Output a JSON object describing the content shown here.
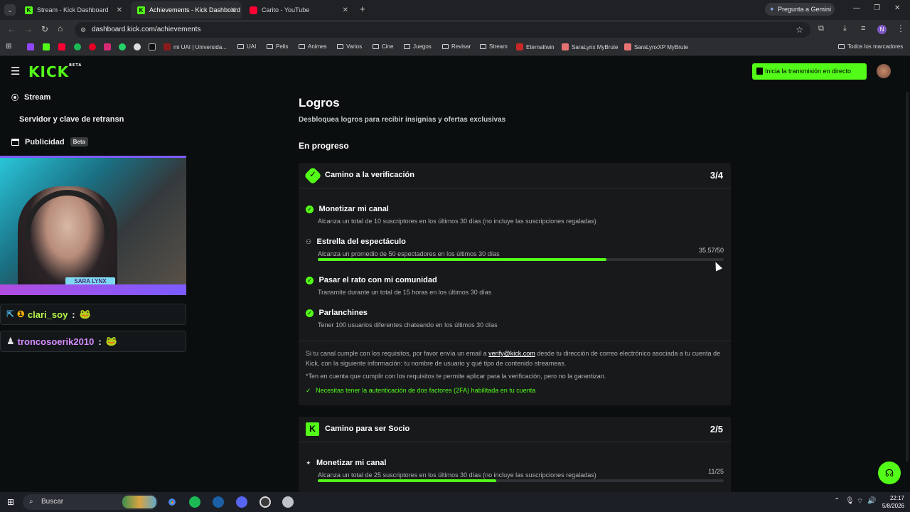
{
  "browser": {
    "tabs": [
      {
        "title": "Stream - Kick Dashboard",
        "active": false
      },
      {
        "title": "Achievements - Kick Dashboard",
        "active": true
      },
      {
        "title": "Carito - YouTube",
        "active": false
      }
    ],
    "gemini_label": "Pregunta a Gemini",
    "url": "dashboard.kick.com/achievements",
    "profile_initial": "N",
    "bookmarks": [
      "mi UAI | Universida...",
      "UAI",
      "Pelis",
      "Animes",
      "Varios",
      "Cine",
      "Juegos",
      "Revisar",
      "Stream",
      "Eternaltwin",
      "SaraLynx MyBrute",
      "SaraLynxXP MyBrute"
    ],
    "all_bookmarks_label": "Todos los marcadores"
  },
  "app": {
    "logo": "KICK",
    "logo_badge": "BETA",
    "go_live_label": "Inicia la transmisión en directo"
  },
  "sidebar": {
    "stream": "Stream",
    "server_key": "Servidor y clave de retransn",
    "ads": "Publicidad",
    "ads_badge": "Beta",
    "cam_overlay_name": "SARA LYNX",
    "chat": [
      {
        "user": "clari_soy",
        "sep": ":"
      },
      {
        "user": "troncosoerik2010",
        "sep": ":"
      }
    ]
  },
  "page": {
    "title": "Logros",
    "subtitle": "Desbloquea logros para recibir insignias y ofertas exclusivas",
    "section": "En progreso",
    "verification": {
      "title": "Camino a la verificación",
      "count": "3/4",
      "items": [
        {
          "title": "Monetizar mi canal",
          "desc": "Alcanza un total de 10 suscriptores en los últimos 30 días (no incluye las suscripciones regaladas)",
          "done": true
        },
        {
          "title": "Estrella del espectáculo",
          "desc": "Alcanza un promedio de 50 espectadores en los últimos 30 días",
          "done": false,
          "progress_text": "35.57/50",
          "progress": 0.7114
        },
        {
          "title": "Pasar el rato con mi comunidad",
          "desc": "Transmite durante un total de 15 horas en los últimos 30 días",
          "done": true
        },
        {
          "title": "Parlanchines",
          "desc": "Tener 100 usuarios diferentes chateando en los últimos 30 días",
          "done": true
        }
      ],
      "note_pre": "Si tu canal cumple con los requisitos, por favor envía un email a ",
      "note_email": "verify@kick.com",
      "note_post": " desde tu dirección de correo electrónico asociada a tu cuenta de Kick, con la siguiente información: tu nombre de usuario y qué tipo de contenido streameas.",
      "note2": "*Ten en cuenta que cumplir con los requisitos te permite aplicar para la verificación, pero no la garantizan.",
      "twofa": "Necesitas tener la autenticación de dos factores (2FA) habilitada en tu cuenta"
    },
    "partner": {
      "title": "Camino para ser Socio",
      "count": "2/5",
      "items": [
        {
          "title": "Monetizar mi canal",
          "desc": "Alcanza un total de 25 suscriptores en los últimos 30 días (no incluye las suscripciones regaladas)",
          "progress_text": "11/25",
          "progress": 0.44
        }
      ]
    }
  },
  "taskbar": {
    "search": "Buscar",
    "time": "22:17",
    "date": "5/8/2026"
  },
  "colors": {
    "accent": "#53fc18",
    "bg": "#0b0e0f",
    "card": "#17191b"
  }
}
